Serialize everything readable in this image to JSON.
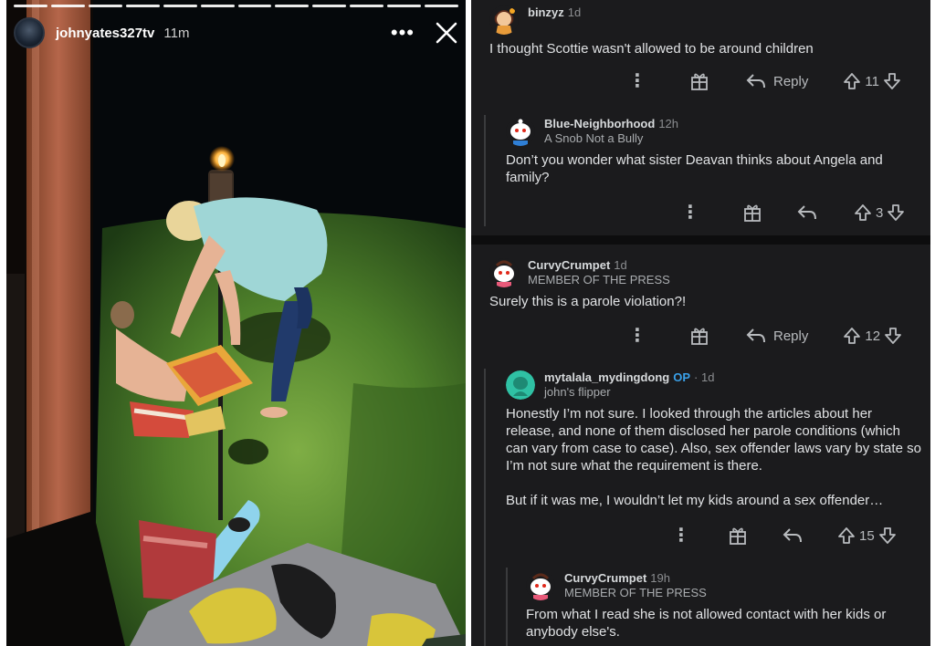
{
  "story": {
    "username": "johnyates327tv",
    "time": "11m",
    "segments": 12,
    "more_icon": "more-horizontal-icon",
    "close_icon": "close-icon"
  },
  "comments": [
    {
      "user": "binzyz",
      "time": "1d",
      "flair": "",
      "body": "I thought Scottie wasn't allowed to be around children",
      "votes": "11",
      "reply_label": "Reply"
    },
    {
      "user": "Blue-Neighborhood",
      "time": "12h",
      "flair": "A Snob Not a Bully",
      "body": "Don’t you wonder what sister Deavan thinks about Angela and family?",
      "votes": "3",
      "reply_label": ""
    },
    {
      "user": "CurvyCrumpet",
      "time": "1d",
      "flair": "MEMBER OF THE PRESS",
      "body": "Surely this is a parole violation?!",
      "votes": "12",
      "reply_label": "Reply"
    },
    {
      "user": "mytalala_mydingdong",
      "op": "OP",
      "time": "· 1d",
      "flair": "john's flipper",
      "body": "Honestly I’m not sure. I looked through the articles about her release, and none of them disclosed her parole conditions (which can vary from case to case). Also, sex offender laws vary by state so I’m not sure what the requirement is there.\n\nBut if it was me, I wouldn’t let my kids around a sex offender…",
      "votes": "15",
      "reply_label": ""
    },
    {
      "user": "CurvyCrumpet",
      "time": "19h",
      "flair": "MEMBER OF THE PRESS",
      "body": "From what I read she is not allowed contact with her kids or anybody else's.",
      "votes": "",
      "reply_label": ""
    }
  ],
  "colors": {
    "reddit_bg": "#1b1b1d",
    "reddit_text": "#d7dadc",
    "op_blue": "#3aa0e8",
    "story_bg": "#070a0c"
  }
}
